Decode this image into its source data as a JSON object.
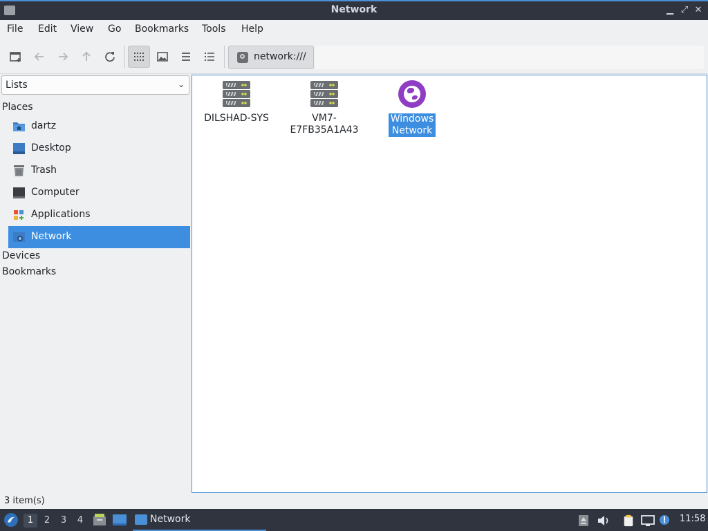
{
  "window": {
    "title": "Network",
    "controls": {
      "minimize": "▁",
      "restore": "⤢",
      "close": "✕"
    }
  },
  "menu": [
    "File",
    "Edit",
    "View",
    "Go",
    "Bookmarks",
    "Tools",
    "Help"
  ],
  "toolbar": {
    "location": "network:///"
  },
  "sidebar": {
    "combo_value": "Lists",
    "places_header": "Places",
    "places": [
      {
        "label": "dartz",
        "icon": "home-folder-icon"
      },
      {
        "label": "Desktop",
        "icon": "desktop-icon"
      },
      {
        "label": "Trash",
        "icon": "trash-icon"
      },
      {
        "label": "Computer",
        "icon": "computer-icon"
      },
      {
        "label": "Applications",
        "icon": "applications-icon"
      },
      {
        "label": "Network",
        "icon": "network-icon",
        "selected": true
      }
    ],
    "devices_header": "Devices",
    "bookmarks_header": "Bookmarks"
  },
  "items": [
    {
      "label": "DILSHAD-SYS",
      "icon": "server-icon"
    },
    {
      "label_line1": "VM7-",
      "label_line2": "E7FB35A1A43",
      "icon": "server-icon"
    },
    {
      "label_line1": "Windows",
      "label_line2": "Network",
      "icon": "globe-network-icon",
      "selected": true
    }
  ],
  "status": {
    "text": "3 item(s)"
  },
  "panel": {
    "workspaces": [
      "1",
      "2",
      "3",
      "4"
    ],
    "active_workspace": "1",
    "task_label": "Network",
    "clock": "11:58"
  },
  "colors": {
    "accent": "#3d8ee0",
    "titlebar": "#2f343f",
    "globe": "#8e3dc4"
  }
}
